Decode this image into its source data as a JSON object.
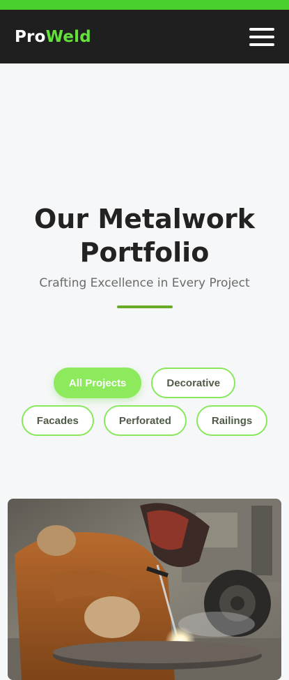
{
  "header": {
    "logo_part1": "Pro",
    "logo_part2": "Weld",
    "menu_icon": "hamburger-menu-icon"
  },
  "hero": {
    "title_line1": "Our Metalwork",
    "title_line2": "Portfolio",
    "subtitle": "Crafting Excellence in Every Project"
  },
  "filters": [
    {
      "label": "All Projects",
      "active": true
    },
    {
      "label": "Decorative",
      "active": false
    },
    {
      "label": "Facades",
      "active": false
    },
    {
      "label": "Perforated",
      "active": false
    },
    {
      "label": "Railings",
      "active": false
    }
  ],
  "colors": {
    "top_strip": "#49d02e",
    "navbar_bg": "#1f1f1f",
    "logo_accent": "#63e13a",
    "filter_border": "#86e85a",
    "filter_active_bg": "#8cea5c",
    "divider": "#6aaa2a"
  }
}
